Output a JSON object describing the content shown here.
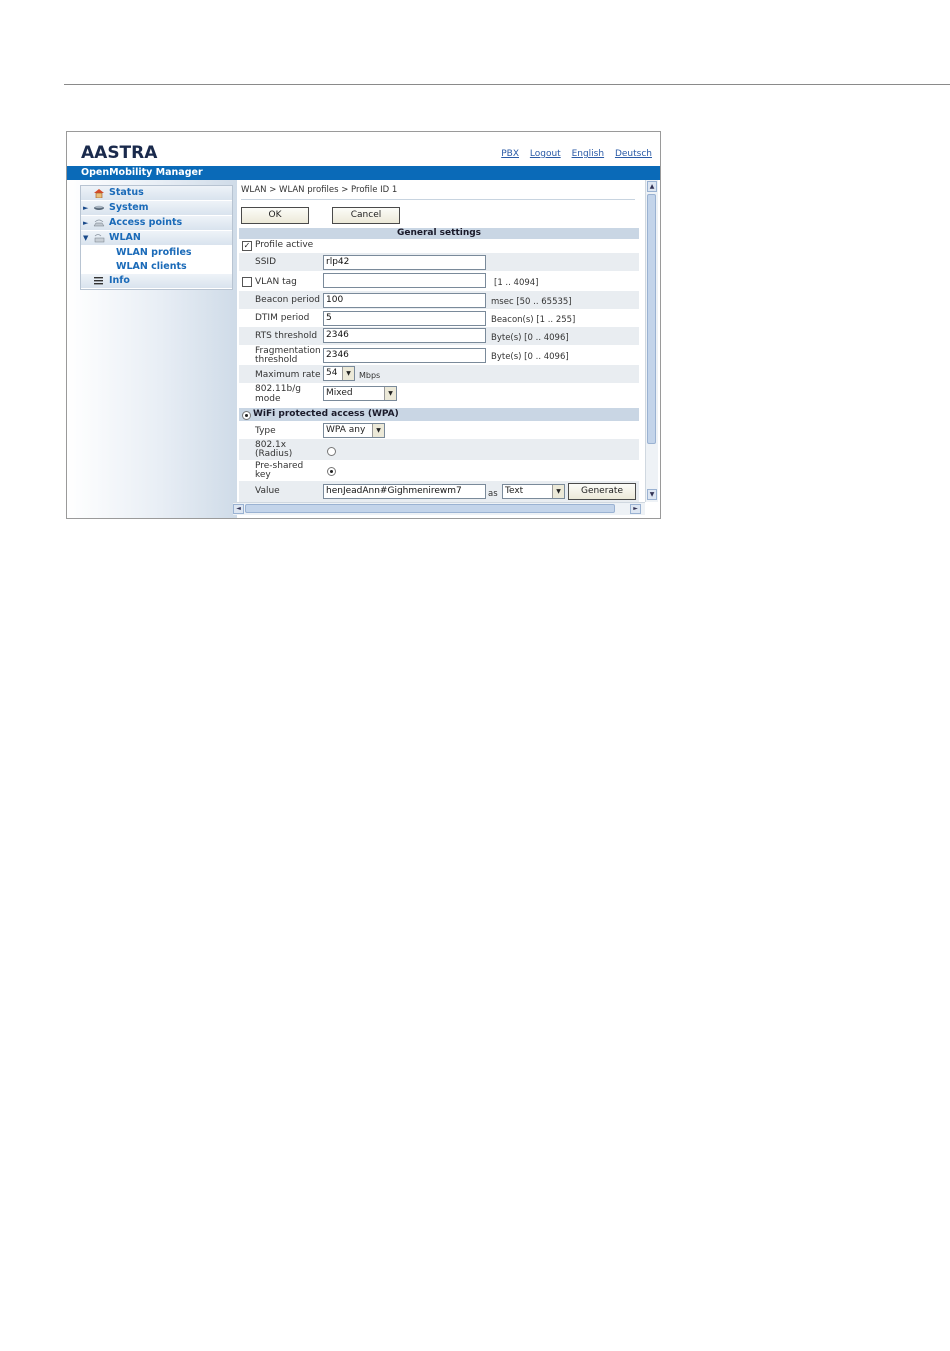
{
  "app": {
    "logo_text": "AASTRA",
    "title_bar": "OpenMobility Manager",
    "top_links": [
      "PBX",
      "Logout",
      "English",
      "Deutsch"
    ]
  },
  "nav": {
    "items": [
      {
        "label": "Status",
        "icon": "home-icon",
        "arrow": ""
      },
      {
        "label": "System",
        "icon": "system-icon",
        "arrow": "►"
      },
      {
        "label": "Access points",
        "icon": "access-point-icon",
        "arrow": "►"
      },
      {
        "label": "WLAN",
        "icon": "wlan-icon",
        "arrow": "▼"
      }
    ],
    "subitems": [
      "WLAN profiles",
      "WLAN clients"
    ],
    "info": {
      "label": "Info",
      "icon": "info-list-icon"
    }
  },
  "content": {
    "breadcrumb": "WLAN > WLAN profiles > Profile ID 1",
    "ok_label": "OK",
    "cancel_label": "Cancel",
    "general_settings": "General settings",
    "profile_active": {
      "label": "Profile active",
      "checked": true
    },
    "ssid": {
      "label": "SSID",
      "value": "rlp42"
    },
    "vlan_tag": {
      "label": "VLAN tag",
      "value": "",
      "hint": "[1 .. 4094]",
      "checked": false
    },
    "beacon_period": {
      "label": "Beacon period",
      "value": "100",
      "hint": "msec [50 .. 65535]"
    },
    "dtim_period": {
      "label": "DTIM period",
      "value": "5",
      "hint": "Beacon(s) [1 .. 255]"
    },
    "rts_threshold": {
      "label": "RTS threshold",
      "value": "2346",
      "hint": "Byte(s) [0 .. 4096]"
    },
    "frag_threshold": {
      "label_line1": "Fragmentation",
      "label_line2": "threshold",
      "value": "2346",
      "hint": "Byte(s) [0 .. 4096]"
    },
    "max_rate": {
      "label": "Maximum rate",
      "value": "54",
      "unit": "Mbps"
    },
    "mode_80211": {
      "label_line1": "802.11b/g",
      "label_line2": "mode",
      "value": "Mixed"
    },
    "wpa": {
      "label": "WiFi protected access (WPA)",
      "selected": true
    },
    "type": {
      "label": "Type",
      "value": "WPA any"
    },
    "radius": {
      "label_line1": "802.1x",
      "label_line2": "(Radius)",
      "selected": false
    },
    "psk": {
      "label_line1": "Pre-shared",
      "label_line2": "key",
      "selected": true
    },
    "value_field": {
      "label": "Value",
      "value": "henJeadAnn#Gighmenirewm7",
      "as_label": "as",
      "format": "Text",
      "generate_label": "Generate"
    }
  }
}
